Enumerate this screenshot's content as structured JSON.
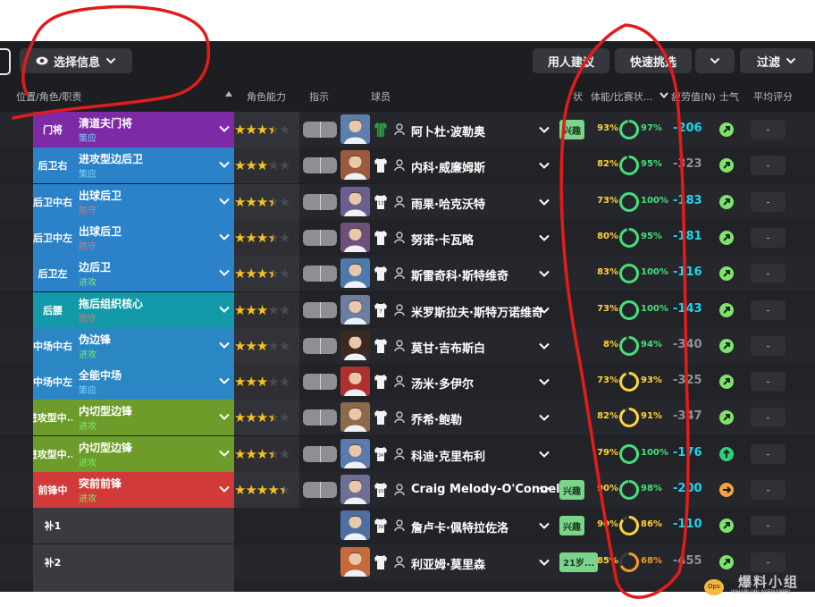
{
  "toolbar": {
    "select_info_label": "选择信息",
    "suggestion_label": "用人建议",
    "quick_pick_label": "快速挑选",
    "filter_label": "过滤"
  },
  "headers": {
    "position": "位置/角色/职责",
    "role_ability": "角色能力",
    "instruction": "指示",
    "player": "球员",
    "status": "状",
    "fitness_match": "体能/比赛状...",
    "fatigue": "疲劳值(N)",
    "morale": "士气",
    "avg_rating": "平均评分"
  },
  "colors": {
    "gk": "#7d2aa6",
    "def_blue": "#2b82c9",
    "dm_teal": "#139aa8",
    "mid_blue": "#2b86c4",
    "am_green": "#6e9c2a",
    "st_red": "#d23a3a",
    "sub_gray": "#3a3b40",
    "stars": "#f7c21e",
    "fatigue_cyan": "#21d4ef",
    "morale_green": "#7de36b"
  },
  "rows": [
    {
      "pos": "门将",
      "role": "清道夫门将",
      "duty": "策应",
      "duty_color": "#7fd6ff",
      "color": "#7d2aa6",
      "stars": 3.5,
      "name": "阿卜杜·波勒奥",
      "tag": "兴趣",
      "fitness": "93%",
      "fitness_color": "#ffd43a",
      "fitness_pct": 0.93,
      "sharp": "97%",
      "sharp_color": "#44e07a",
      "sharp_pct": 0.97,
      "fatigue": "-206",
      "fatigue_color": "#21d4ef",
      "morale_color": "#7de36b",
      "morale_icon": "arrow-up-right",
      "rating": "-",
      "avatar_color": "#5c7fae",
      "shirt": "green"
    },
    {
      "pos": "后卫右",
      "role": "进攻型边后卫",
      "duty": "策应",
      "duty_color": "#7fd6ff",
      "color": "#2b82c9",
      "stars": 3,
      "name": "内科·威廉姆斯",
      "tag": "",
      "fitness": "82%",
      "fitness_color": "#ffd43a",
      "fitness_pct": 0.82,
      "sharp": "95%",
      "sharp_color": "#44e07a",
      "sharp_pct": 0.95,
      "fatigue": "-323",
      "fatigue_color": "#8f9196",
      "morale_color": "#7de36b",
      "morale_icon": "arrow-up-right",
      "rating": "-",
      "avatar_color": "#9a5a3e",
      "shirt": "white"
    },
    {
      "pos": "后卫中右",
      "role": "出球后卫",
      "duty": "防守",
      "duty_color": "#ff6b6b",
      "color": "#2b82c9",
      "stars": 3.5,
      "name": "雨果·哈克沃特",
      "tag": "",
      "fitness": "73%",
      "fitness_color": "#ffd43a",
      "fitness_pct": 0.73,
      "sharp": "100%",
      "sharp_color": "#44e07a",
      "sharp_pct": 1.0,
      "fatigue": "-183",
      "fatigue_color": "#21d4ef",
      "morale_color": "#7de36b",
      "morale_icon": "arrow-up-right",
      "rating": "-",
      "avatar_color": "#6a5f8f",
      "shirt": "white13"
    },
    {
      "pos": "后卫中左",
      "role": "出球后卫",
      "duty": "防守",
      "duty_color": "#ff6b6b",
      "color": "#2b82c9",
      "stars": 3.5,
      "name": "努诺·卡瓦略",
      "tag": "",
      "fitness": "80%",
      "fitness_color": "#ffd43a",
      "fitness_pct": 0.8,
      "sharp": "95%",
      "sharp_color": "#44e07a",
      "sharp_pct": 0.95,
      "fatigue": "-181",
      "fatigue_color": "#21d4ef",
      "morale_color": "#7de36b",
      "morale_icon": "arrow-up-right",
      "rating": "-",
      "avatar_color": "#6e4e7a",
      "shirt": "white"
    },
    {
      "pos": "后卫左",
      "role": "边后卫",
      "duty": "进攻",
      "duty_color": "#7be86b",
      "color": "#2b82c9",
      "stars": 3.5,
      "name": "斯雷奇科·斯特维奇",
      "tag": "",
      "fitness": "83%",
      "fitness_color": "#ffd43a",
      "fitness_pct": 0.83,
      "sharp": "100%",
      "sharp_color": "#44e07a",
      "sharp_pct": 1.0,
      "fatigue": "-116",
      "fatigue_color": "#21d4ef",
      "morale_color": "#7de36b",
      "morale_icon": "arrow-up-right",
      "rating": "-",
      "avatar_color": "#4e79ad",
      "shirt": "white"
    },
    {
      "pos": "后腰",
      "role": "拖后组织核心",
      "duty": "防守",
      "duty_color": "#ff6b6b",
      "color": "#139aa8",
      "stars": 3,
      "name": "米罗斯拉夫·斯特万诺维奇",
      "tag": "",
      "fitness": "73%",
      "fitness_color": "#ffd43a",
      "fitness_pct": 0.73,
      "sharp": "100%",
      "sharp_color": "#44e07a",
      "sharp_pct": 1.0,
      "fatigue": "-143",
      "fatigue_color": "#21d4ef",
      "morale_color": "#7de36b",
      "morale_icon": "arrow-up-right",
      "rating": "-",
      "avatar_color": "#6c7ea0",
      "shirt": "white7"
    },
    {
      "pos": "中场中右",
      "role": "伪边锋",
      "duty": "进攻",
      "duty_color": "#7be86b",
      "color": "#2b86c4",
      "stars": 3,
      "name": "莫甘·吉布斯白",
      "tag": "",
      "fitness": "8%",
      "fitness_color": "#ffd43a",
      "fitness_pct": 0.84,
      "sharp": "94%",
      "sharp_color": "#44e07a",
      "sharp_pct": 0.94,
      "fatigue": "-340",
      "fatigue_color": "#8f9196",
      "morale_color": "#7de36b",
      "morale_icon": "arrow-up-right",
      "rating": "-",
      "avatar_color": "#3a2a22",
      "shirt": "white"
    },
    {
      "pos": "中场中左",
      "role": "全能中场",
      "duty": "策应",
      "duty_color": "#7fd6ff",
      "color": "#2b86c4",
      "stars": 3,
      "name": "汤米·多伊尔",
      "tag": "",
      "fitness": "73%",
      "fitness_color": "#ffd43a",
      "fitness_pct": 0.73,
      "sharp": "93%",
      "sharp_color": "#ffd43a",
      "sharp_pct": 0.93,
      "fatigue": "-325",
      "fatigue_color": "#8f9196",
      "morale_color": "#7de36b",
      "morale_icon": "arrow-up-right",
      "rating": "-",
      "avatar_color": "#b03030",
      "shirt": "white"
    },
    {
      "pos": "进攻型中...",
      "role": "内切型边锋",
      "duty": "进攻",
      "duty_color": "#7be86b",
      "color": "#6e9c2a",
      "stars": 3.5,
      "name": "乔希·鲍勒",
      "tag": "",
      "fitness": "82%",
      "fitness_color": "#ffd43a",
      "fitness_pct": 0.82,
      "sharp": "91%",
      "sharp_color": "#ffd43a",
      "sharp_pct": 0.91,
      "fatigue": "-347",
      "fatigue_color": "#8f9196",
      "morale_color": "#7de36b",
      "morale_icon": "arrow-up-right",
      "rating": "-",
      "avatar_color": "#8d6a4a",
      "shirt": "white"
    },
    {
      "pos": "进攻型中...",
      "role": "内切型边锋",
      "duty": "进攻",
      "duty_color": "#7be86b",
      "color": "#6e9c2a",
      "stars": 3.5,
      "name": "科迪·克里布利",
      "tag": "",
      "fitness": "79%",
      "fitness_color": "#ffd43a",
      "fitness_pct": 0.79,
      "sharp": "100%",
      "sharp_color": "#44e07a",
      "sharp_pct": 1.0,
      "fatigue": "-176",
      "fatigue_color": "#21d4ef",
      "morale_color": "#2fd07a",
      "morale_icon": "arrow-up",
      "rating": "-",
      "avatar_color": "#5a7ab0",
      "shirt": "white34"
    },
    {
      "pos": "前锋中",
      "role": "突前前锋",
      "duty": "进攻",
      "duty_color": "#7be86b",
      "color": "#d23a3a",
      "stars": 4.5,
      "name": "Craig Melody-O'Connell",
      "tag": "兴趣",
      "fitness": "90%",
      "fitness_color": "#ffd43a",
      "fitness_pct": 0.9,
      "sharp": "98%",
      "sharp_color": "#44e07a",
      "sharp_pct": 0.98,
      "fatigue": "-200",
      "fatigue_color": "#21d4ef",
      "morale_color": "#f5a142",
      "morale_icon": "arrow-right",
      "rating": "-",
      "avatar_color": "#6d6f95",
      "shirt": "white10"
    },
    {
      "pos": "补1",
      "role": "",
      "duty": "",
      "duty_color": "#ffffff",
      "color": "#3a3b40",
      "stars": 0,
      "name": "詹卢卡·佩特拉佐洛",
      "tag": "兴趣",
      "fitness": "90%",
      "fitness_color": "#ffd43a",
      "fitness_pct": 0.9,
      "sharp": "86%",
      "sharp_color": "#ffd43a",
      "sharp_pct": 0.86,
      "fatigue": "-110",
      "fatigue_color": "#21d4ef",
      "morale_color": "#7de36b",
      "morale_icon": "arrow-up-right",
      "rating": "-",
      "avatar_color": "#4f6fa2",
      "shirt": "white39"
    },
    {
      "pos": "补2",
      "role": "",
      "duty": "",
      "duty_color": "#ffffff",
      "color": "#3a3b40",
      "stars": 0,
      "name": "利亚姆·莫里森",
      "tag": "21岁...",
      "fitness": "85%",
      "fitness_color": "#ffd43a",
      "fitness_pct": 0.85,
      "sharp": "68%",
      "sharp_color": "#f59a2a",
      "sharp_pct": 0.68,
      "fatigue": "-455",
      "fatigue_color": "#8f9196",
      "morale_color": "#7de36b",
      "morale_icon": "arrow-up-right",
      "rating": "-",
      "avatar_color": "#c9683a",
      "shirt": "white"
    },
    {
      "pos": "",
      "role": "",
      "duty": "",
      "duty_color": "#ffffff",
      "color": "#3a3b40",
      "stars": 0,
      "name": "",
      "tag": "",
      "fitness": "",
      "fitness_color": "#ffd43a",
      "fitness_pct": 0,
      "sharp": "",
      "sharp_color": "#44e07a",
      "sharp_pct": 0,
      "fatigue": "",
      "fatigue_color": "#8f9196",
      "morale_color": "#7de36b",
      "morale_icon": "",
      "rating": "",
      "avatar_color": "#4f6fa2",
      "shirt": "white"
    }
  ],
  "watermark": {
    "text": "爆料小组",
    "sub": "WHAPLUBLAYEMAPPBL"
  }
}
